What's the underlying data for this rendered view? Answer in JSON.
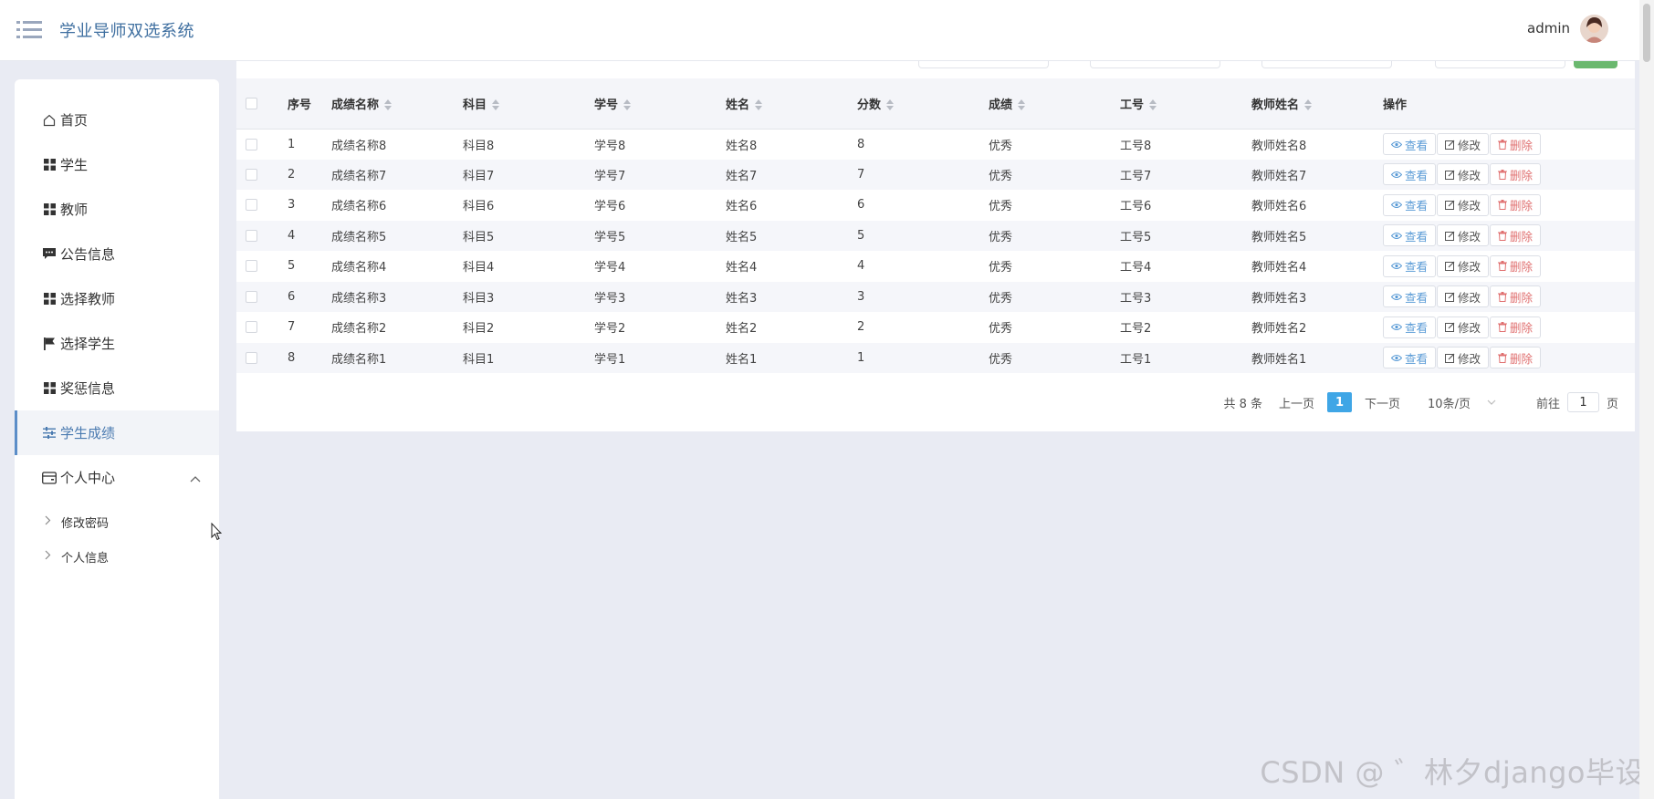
{
  "app": {
    "title": "学业导师双选系统"
  },
  "user": {
    "name": "admin"
  },
  "sidebar": {
    "items": [
      {
        "label": "首页",
        "icon": "home-icon"
      },
      {
        "label": "学生",
        "icon": "grid-icon"
      },
      {
        "label": "教师",
        "icon": "grid-icon"
      },
      {
        "label": "公告信息",
        "icon": "message-icon"
      },
      {
        "label": "选择教师",
        "icon": "grid-icon"
      },
      {
        "label": "选择学生",
        "icon": "flag-icon"
      },
      {
        "label": "奖惩信息",
        "icon": "grid-icon"
      },
      {
        "label": "学生成绩",
        "icon": "sliders-icon",
        "active": true
      },
      {
        "label": "个人中心",
        "icon": "wallet-icon",
        "expanded": true
      }
    ],
    "subitems": [
      {
        "label": "修改密码"
      },
      {
        "label": "个人信息"
      }
    ]
  },
  "table": {
    "columns": [
      "序号",
      "成绩名称",
      "科目",
      "学号",
      "姓名",
      "分数",
      "成绩",
      "工号",
      "教师姓名",
      "操作"
    ],
    "rows": [
      [
        "1",
        "成绩名称8",
        "科目8",
        "学号8",
        "姓名8",
        "8",
        "优秀",
        "工号8",
        "教师姓名8"
      ],
      [
        "2",
        "成绩名称7",
        "科目7",
        "学号7",
        "姓名7",
        "7",
        "优秀",
        "工号7",
        "教师姓名7"
      ],
      [
        "3",
        "成绩名称6",
        "科目6",
        "学号6",
        "姓名6",
        "6",
        "优秀",
        "工号6",
        "教师姓名6"
      ],
      [
        "4",
        "成绩名称5",
        "科目5",
        "学号5",
        "姓名5",
        "5",
        "优秀",
        "工号5",
        "教师姓名5"
      ],
      [
        "5",
        "成绩名称4",
        "科目4",
        "学号4",
        "姓名4",
        "4",
        "优秀",
        "工号4",
        "教师姓名4"
      ],
      [
        "6",
        "成绩名称3",
        "科目3",
        "学号3",
        "姓名3",
        "3",
        "优秀",
        "工号3",
        "教师姓名3"
      ],
      [
        "7",
        "成绩名称2",
        "科目2",
        "学号2",
        "姓名2",
        "2",
        "优秀",
        "工号2",
        "教师姓名2"
      ],
      [
        "8",
        "成绩名称1",
        "科目1",
        "学号1",
        "姓名1",
        "1",
        "优秀",
        "工号1",
        "教师姓名1"
      ]
    ],
    "actions": {
      "view": "查看",
      "edit": "修改",
      "delete": "删除"
    }
  },
  "pagination": {
    "total": "共 8 条",
    "prev": "上一页",
    "current": "1",
    "next": "下一页",
    "page_size": "10条/页",
    "goto_prefix": "前往",
    "goto_value": "1",
    "goto_suffix": "页"
  },
  "watermark": "CSDN @ ゛林夕django毕设",
  "colors": {
    "accent": "#3fa6e6",
    "active_menu": "#4a7ab0",
    "delete": "#e07070",
    "view": "#5a9bd6",
    "search_button": "#6ab86f"
  }
}
